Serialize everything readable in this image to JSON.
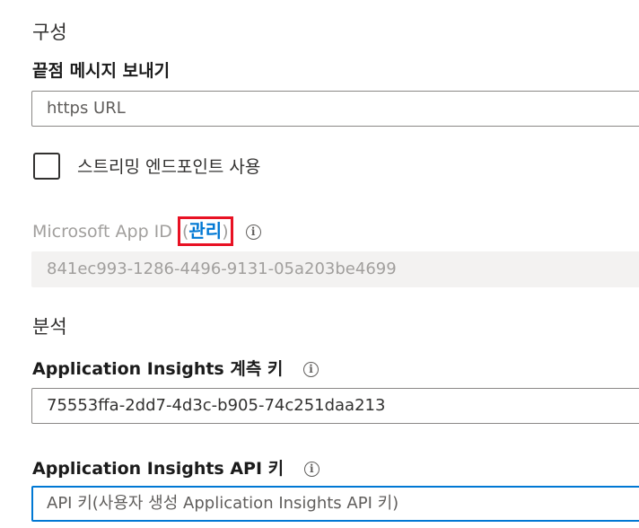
{
  "sections": {
    "configuration": "구성",
    "analytics": "분석"
  },
  "messaging_endpoint": {
    "label": "끝점 메시지 보내기",
    "placeholder": "https URL"
  },
  "streaming": {
    "label": "스트리밍 엔드포인트 사용"
  },
  "app_id": {
    "label": "Microsoft App ID",
    "open_paren": "(",
    "manage_link": "관리",
    "close_paren": ")",
    "value": "841ec993-1286-4496-9131-05a203be4699"
  },
  "instrumentation_key": {
    "label": "Application Insights 계측 키",
    "value": "75553ffa-2dd7-4d3c-b905-74c251daa213"
  },
  "api_key": {
    "label": "Application Insights API 키",
    "placeholder": "API 키(사용자 생성 Application Insights API 키)"
  },
  "icons": {
    "info": "ⓘ"
  },
  "colors": {
    "accent": "#0078d4",
    "highlight_box": "#e81123",
    "disabled_text": "#a19f9d"
  }
}
